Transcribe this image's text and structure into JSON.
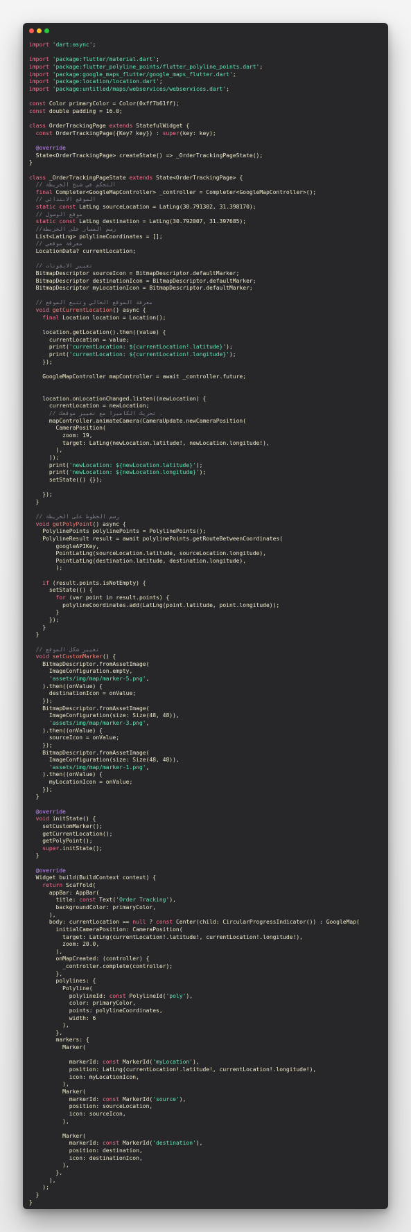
{
  "window": {
    "controls": [
      {
        "name": "close",
        "color": "#ff5f57"
      },
      {
        "name": "minimize",
        "color": "#febc2e"
      },
      {
        "name": "maximize",
        "color": "#28c840"
      }
    ]
  },
  "colors": {
    "keyword": "#ff6d8e",
    "string": "#63e6b5",
    "function": "#ff7b72",
    "comment": "#7c7f8c",
    "annotation": "#c58cff",
    "plain": "#f0eacc",
    "background": "#272729"
  },
  "code_lines": [
    [
      [
        "k",
        "import "
      ],
      [
        "s",
        "'dart:async'"
      ],
      [
        "p",
        ";"
      ]
    ],
    [],
    [
      [
        "k",
        "import "
      ],
      [
        "s",
        "'package:flutter/material.dart'"
      ],
      [
        "p",
        ";"
      ]
    ],
    [
      [
        "k",
        "import "
      ],
      [
        "s",
        "'package:flutter_polyline_points/flutter_polyline_points.dart'"
      ],
      [
        "p",
        ";"
      ]
    ],
    [
      [
        "k",
        "import "
      ],
      [
        "s",
        "'package:google_maps_flutter/google_maps_flutter.dart'"
      ],
      [
        "p",
        ";"
      ]
    ],
    [
      [
        "k",
        "import "
      ],
      [
        "s",
        "'package:location/location.dart'"
      ],
      [
        "p",
        ";"
      ]
    ],
    [
      [
        "k",
        "import "
      ],
      [
        "s",
        "'package:untitled/maps/webservices/webservices.dart'"
      ],
      [
        "p",
        ";"
      ]
    ],
    [],
    [
      [
        "k",
        "const "
      ],
      [
        "p",
        "Color primaryColor = Color(0xff7b61ff);"
      ]
    ],
    [
      [
        "k",
        "const "
      ],
      [
        "p",
        "double padding = 16.0;"
      ]
    ],
    [],
    [
      [
        "k",
        "class "
      ],
      [
        "p",
        "OrderTrackingPage "
      ],
      [
        "k",
        "extends "
      ],
      [
        "p",
        "StatefulWidget {"
      ]
    ],
    [
      [
        "p",
        "  "
      ],
      [
        "k",
        "const "
      ],
      [
        "p",
        "OrderTrackingPage({Key? key}) : "
      ],
      [
        "k",
        "super"
      ],
      [
        "p",
        "(key: key);"
      ]
    ],
    [],
    [
      [
        "p",
        "  "
      ],
      [
        "a",
        "@override"
      ]
    ],
    [
      [
        "p",
        "  State<OrderTrackingPage> createState() => _OrderTrackingPageState();"
      ]
    ],
    [
      [
        "p",
        "}"
      ]
    ],
    [],
    [
      [
        "k",
        "class "
      ],
      [
        "p",
        "_OrderTrackingPageState "
      ],
      [
        "k",
        "extends "
      ],
      [
        "p",
        "State<OrderTrackingPage> {"
      ]
    ],
    [
      [
        "c",
        "  // التحكم في شبح الخريطة"
      ]
    ],
    [
      [
        "p",
        "  "
      ],
      [
        "k",
        "final "
      ],
      [
        "p",
        "Completer<GoogleMapController> _controller = Completer<GoogleMapController>();"
      ]
    ],
    [
      [
        "c",
        "  // الموقع الابتدائي"
      ]
    ],
    [
      [
        "p",
        "  "
      ],
      [
        "k",
        "static const "
      ],
      [
        "p",
        "LatLng sourceLocation = LatLng(30.791302, 31.398170);"
      ]
    ],
    [
      [
        "c",
        "  // موقع الوصول"
      ]
    ],
    [
      [
        "p",
        "  "
      ],
      [
        "k",
        "static const "
      ],
      [
        "p",
        "LatLng destination = LatLng(30.792007, 31.397685);"
      ]
    ],
    [
      [
        "c",
        "  //رسم المسار على الخريطة"
      ]
    ],
    [
      [
        "p",
        "  List<LatLng> polylineCoordinates = [];"
      ]
    ],
    [
      [
        "c",
        "  // معرفة موقعي"
      ]
    ],
    [
      [
        "p",
        "  LocationData? currentLocation;"
      ]
    ],
    [],
    [
      [
        "c",
        "  // تغيير الايقونات"
      ]
    ],
    [
      [
        "p",
        "  BitmapDescriptor sourceIcon = BitmapDescriptor.defaultMarker;"
      ]
    ],
    [
      [
        "p",
        "  BitmapDescriptor destinationIcon = BitmapDescriptor.defaultMarker;"
      ]
    ],
    [
      [
        "p",
        "  BitmapDescriptor myLocationIcon = BitmapDescriptor.defaultMarker;"
      ]
    ],
    [],
    [
      [
        "c",
        "  // معرفة الموقع الحالي وتتبع الموقع"
      ]
    ],
    [
      [
        "p",
        "  "
      ],
      [
        "k",
        "void "
      ],
      [
        "f",
        "getCurrentLocation"
      ],
      [
        "p",
        "() async {"
      ]
    ],
    [
      [
        "p",
        "    "
      ],
      [
        "k",
        "final "
      ],
      [
        "p",
        "Location location = Location();"
      ]
    ],
    [],
    [
      [
        "p",
        "    location.getLocation().then((value) {"
      ]
    ],
    [
      [
        "p",
        "      currentLocation = value;"
      ]
    ],
    [
      [
        "p",
        "      print("
      ],
      [
        "s",
        "'currentLocation: ${currentLocation!.latitude}'"
      ],
      [
        "p",
        ");"
      ]
    ],
    [
      [
        "p",
        "      print("
      ],
      [
        "s",
        "'currentLocation: ${currentLocation!.longitude}'"
      ],
      [
        "p",
        ");"
      ]
    ],
    [
      [
        "p",
        "    });"
      ]
    ],
    [],
    [
      [
        "p",
        "    GoogleMapController mapController = await _controller.future;"
      ]
    ],
    [],
    [],
    [
      [
        "p",
        "    location.onLocationChanged.listen((newLocation) {"
      ]
    ],
    [
      [
        "p",
        "      currentLocation = newLocation;"
      ]
    ],
    [
      [
        "c",
        "      // تحريك الكاميرا مع تغيير موقعك ."
      ]
    ],
    [
      [
        "p",
        "      mapController.animateCamera(CameraUpdate.newCameraPosition("
      ]
    ],
    [
      [
        "p",
        "        CameraPosition("
      ]
    ],
    [
      [
        "p",
        "          zoom: 19,"
      ]
    ],
    [
      [
        "p",
        "          target: LatLng(newLocation.latitude!, newLocation.longitude!),"
      ]
    ],
    [
      [
        "p",
        "        ),"
      ]
    ],
    [
      [
        "p",
        "      ));"
      ]
    ],
    [
      [
        "p",
        "      print("
      ],
      [
        "s",
        "'newLocation: ${newLocation.latitude}'"
      ],
      [
        "p",
        ");"
      ]
    ],
    [
      [
        "p",
        "      print("
      ],
      [
        "s",
        "'newLocation: ${newLocation.longitude}'"
      ],
      [
        "p",
        ");"
      ]
    ],
    [
      [
        "p",
        "      setState(() {});"
      ]
    ],
    [],
    [
      [
        "p",
        "    });"
      ]
    ],
    [
      [
        "p",
        "  }"
      ]
    ],
    [],
    [
      [
        "c",
        "  // رسم الخطوط على الخريطة"
      ]
    ],
    [
      [
        "p",
        "  "
      ],
      [
        "k",
        "void "
      ],
      [
        "f",
        "getPolyPoint"
      ],
      [
        "p",
        "() async {"
      ]
    ],
    [
      [
        "p",
        "    PolylinePoints polylinePoints = PolylinePoints();"
      ]
    ],
    [
      [
        "p",
        "    PolylineResult result = await polylinePoints.getRouteBetweenCoordinates("
      ]
    ],
    [
      [
        "p",
        "        googleAPIKey,"
      ]
    ],
    [
      [
        "p",
        "        PointLatLng(sourceLocation.latitude, sourceLocation.longitude),"
      ]
    ],
    [
      [
        "p",
        "        PointLatLng(destination.latitude, destination.longitude),"
      ]
    ],
    [
      [
        "p",
        "        );"
      ]
    ],
    [],
    [
      [
        "p",
        "    "
      ],
      [
        "k",
        "if "
      ],
      [
        "p",
        "(result.points.isNotEmpty) {"
      ]
    ],
    [
      [
        "p",
        "      setState(() {"
      ]
    ],
    [
      [
        "p",
        "        "
      ],
      [
        "k",
        "for "
      ],
      [
        "p",
        "(var point in result.points) {"
      ]
    ],
    [
      [
        "p",
        "          polylineCoordinates.add(LatLng(point.latitude, point.longitude));"
      ]
    ],
    [
      [
        "p",
        "        }"
      ]
    ],
    [
      [
        "p",
        "      });"
      ]
    ],
    [
      [
        "p",
        "    }"
      ]
    ],
    [
      [
        "p",
        "  }"
      ]
    ],
    [],
    [
      [
        "c",
        "  // تغيير شكل الموقع"
      ]
    ],
    [
      [
        "p",
        "  "
      ],
      [
        "k",
        "void "
      ],
      [
        "f",
        "setCustomMarker"
      ],
      [
        "p",
        "() {"
      ]
    ],
    [
      [
        "p",
        "    BitmapDescriptor.fromAssetImage("
      ]
    ],
    [
      [
        "p",
        "      ImageConfiguration.empty,"
      ]
    ],
    [
      [
        "p",
        "      "
      ],
      [
        "s",
        "'assets/img/map/marker-5.png'"
      ],
      [
        "p",
        ","
      ]
    ],
    [
      [
        "p",
        "    ).then((onValue) {"
      ]
    ],
    [
      [
        "p",
        "      destinationIcon = onValue;"
      ]
    ],
    [
      [
        "p",
        "    });"
      ]
    ],
    [
      [
        "p",
        "    BitmapDescriptor.fromAssetImage("
      ]
    ],
    [
      [
        "p",
        "      ImageConfiguration(size: Size(48, 48)),"
      ]
    ],
    [
      [
        "p",
        "      "
      ],
      [
        "s",
        "'assets/img/map/marker-3.png'"
      ],
      [
        "p",
        ","
      ]
    ],
    [
      [
        "p",
        "    ).then((onValue) {"
      ]
    ],
    [
      [
        "p",
        "      sourceIcon = onValue;"
      ]
    ],
    [
      [
        "p",
        "    });"
      ]
    ],
    [
      [
        "p",
        "    BitmapDescriptor.fromAssetImage("
      ]
    ],
    [
      [
        "p",
        "      ImageConfiguration(size: Size(48, 48)),"
      ]
    ],
    [
      [
        "p",
        "      "
      ],
      [
        "s",
        "'assets/img/map/marker-1.png'"
      ],
      [
        "p",
        ","
      ]
    ],
    [
      [
        "p",
        "    ).then((onValue) {"
      ]
    ],
    [
      [
        "p",
        "      myLocationIcon = onValue;"
      ]
    ],
    [
      [
        "p",
        "    });"
      ]
    ],
    [
      [
        "p",
        "  }"
      ]
    ],
    [],
    [
      [
        "p",
        "  "
      ],
      [
        "a",
        "@override"
      ]
    ],
    [
      [
        "p",
        "  "
      ],
      [
        "k",
        "void "
      ],
      [
        "p",
        "initState() {"
      ]
    ],
    [
      [
        "p",
        "    setCustomMarker();"
      ]
    ],
    [
      [
        "p",
        "    getCurrentLocation();"
      ]
    ],
    [
      [
        "p",
        "    getPolyPoint();"
      ]
    ],
    [
      [
        "p",
        "    "
      ],
      [
        "k",
        "super"
      ],
      [
        "p",
        ".initState();"
      ]
    ],
    [
      [
        "p",
        "  }"
      ]
    ],
    [],
    [
      [
        "p",
        "  "
      ],
      [
        "a",
        "@override"
      ]
    ],
    [
      [
        "p",
        "  Widget build(BuildContext context) {"
      ]
    ],
    [
      [
        "p",
        "    "
      ],
      [
        "k",
        "return "
      ],
      [
        "p",
        "Scaffold("
      ]
    ],
    [
      [
        "p",
        "      appBar: AppBar("
      ]
    ],
    [
      [
        "p",
        "        title: "
      ],
      [
        "k",
        "const "
      ],
      [
        "p",
        "Text("
      ],
      [
        "s",
        "'Order Tracking'"
      ],
      [
        "p",
        "),"
      ]
    ],
    [
      [
        "p",
        "        backgroundColor: primaryColor,"
      ]
    ],
    [
      [
        "p",
        "      ),"
      ]
    ],
    [
      [
        "p",
        "      body: currentLocation == "
      ],
      [
        "k",
        "null "
      ],
      [
        "p",
        "? "
      ],
      [
        "k",
        "const "
      ],
      [
        "p",
        "Center(child: CircularProgressIndicator()) : GoogleMap("
      ]
    ],
    [
      [
        "p",
        "        initialCameraPosition: CameraPosition("
      ]
    ],
    [
      [
        "p",
        "          target: LatLng(currentLocation!.latitude!, currentLocation!.longitude!),"
      ]
    ],
    [
      [
        "p",
        "          zoom: 20.0,"
      ]
    ],
    [
      [
        "p",
        "        ),"
      ]
    ],
    [
      [
        "p",
        "        onMapCreated: (controller) {"
      ]
    ],
    [
      [
        "p",
        "          _controller.complete(controller);"
      ]
    ],
    [
      [
        "p",
        "        },"
      ]
    ],
    [
      [
        "p",
        "        polylines: {"
      ]
    ],
    [
      [
        "p",
        "          Polyline("
      ]
    ],
    [
      [
        "p",
        "            polylineId: "
      ],
      [
        "k",
        "const "
      ],
      [
        "p",
        "PolylineId("
      ],
      [
        "s",
        "'poly'"
      ],
      [
        "p",
        "),"
      ]
    ],
    [
      [
        "p",
        "            color: primaryColor,"
      ]
    ],
    [
      [
        "p",
        "            points: polylineCoordinates,"
      ]
    ],
    [
      [
        "p",
        "            width: 6"
      ]
    ],
    [
      [
        "p",
        "          ),"
      ]
    ],
    [
      [
        "p",
        "        },"
      ]
    ],
    [
      [
        "p",
        "        markers: {"
      ]
    ],
    [
      [
        "p",
        "          Marker("
      ]
    ],
    [],
    [
      [
        "p",
        "            markerId: "
      ],
      [
        "k",
        "const "
      ],
      [
        "p",
        "MarkerId("
      ],
      [
        "s",
        "'myLocation'"
      ],
      [
        "p",
        "),"
      ]
    ],
    [
      [
        "p",
        "            position: LatLng(currentLocation!.latitude!, currentLocation!.longitude!),"
      ]
    ],
    [
      [
        "p",
        "            icon: myLocationIcon,"
      ]
    ],
    [
      [
        "p",
        "          ),"
      ]
    ],
    [
      [
        "p",
        "          Marker("
      ]
    ],
    [
      [
        "p",
        "            markerId: "
      ],
      [
        "k",
        "const "
      ],
      [
        "p",
        "MarkerId("
      ],
      [
        "s",
        "'source'"
      ],
      [
        "p",
        "),"
      ]
    ],
    [
      [
        "p",
        "            position: sourceLocation,"
      ]
    ],
    [
      [
        "p",
        "            icon: sourceIcon,"
      ]
    ],
    [
      [
        "p",
        "          ),"
      ]
    ],
    [],
    [
      [
        "p",
        "          Marker("
      ]
    ],
    [
      [
        "p",
        "            markerId: "
      ],
      [
        "k",
        "const "
      ],
      [
        "p",
        "MarkerId("
      ],
      [
        "s",
        "'destination'"
      ],
      [
        "p",
        "),"
      ]
    ],
    [
      [
        "p",
        "            position: destination,"
      ]
    ],
    [
      [
        "p",
        "            icon: destinationIcon,"
      ]
    ],
    [
      [
        "p",
        "          ),"
      ]
    ],
    [
      [
        "p",
        "        },"
      ]
    ],
    [
      [
        "p",
        "      ),"
      ]
    ],
    [
      [
        "p",
        "    );"
      ]
    ],
    [
      [
        "p",
        "  }"
      ]
    ],
    [
      [
        "p",
        "}"
      ]
    ]
  ]
}
